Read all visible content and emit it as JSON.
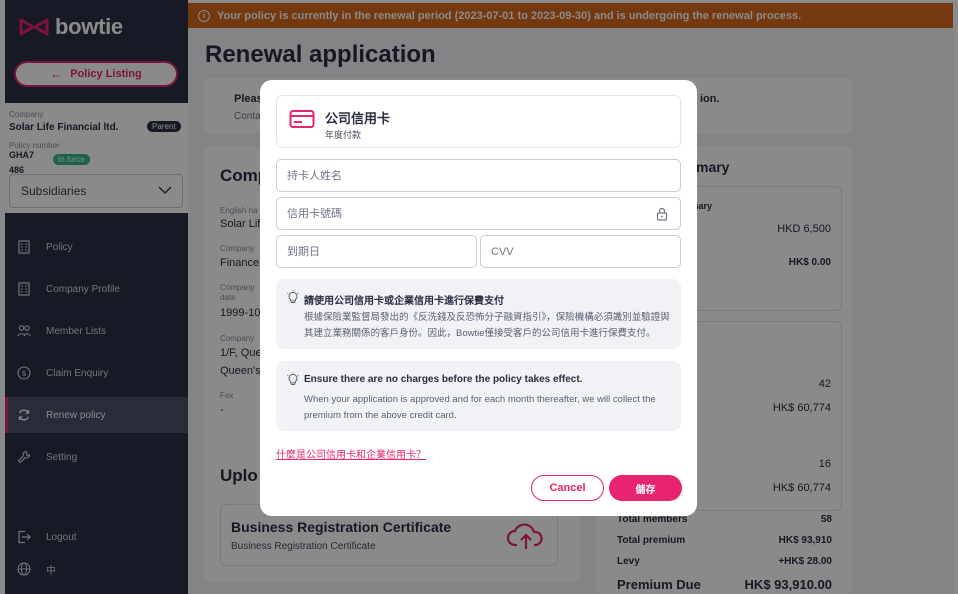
{
  "colors": {
    "brand_pink": "#e8236f",
    "sidebar_bg": "#2c3145",
    "banner_orange": "#d9691c",
    "status_green": "#35b889"
  },
  "app": {
    "logo_text": "bowtie"
  },
  "banner": {
    "text": "Your policy is currently in the renewal period (2023-07-01 to 2023-09-30) and is undergoing the renewal process."
  },
  "sidebar": {
    "policy_listing_label": "Policy Listing",
    "company_label": "Company",
    "company_name": "Solar Life Financial ltd.",
    "parent_badge": "Parent",
    "policy_number_label": "Policy number",
    "policy_number": "GHA7 486",
    "status_badge": "In force",
    "subsidiaries_label": "Subsidiaries",
    "nav": [
      {
        "label": "Policy",
        "icon": "building-icon"
      },
      {
        "label": "Company Profile",
        "icon": "building-icon"
      },
      {
        "label": "Member Lists",
        "icon": "members-icon"
      },
      {
        "label": "Claim Enquiry",
        "icon": "dollar-icon"
      },
      {
        "label": "Renew policy",
        "icon": "renew-icon"
      },
      {
        "label": "Setting",
        "icon": "wrench-icon"
      }
    ],
    "logout_label": "Logout",
    "language_label": "中"
  },
  "main": {
    "page_title": "Renewal application",
    "tip_partial": "Please",
    "tip_partial_2": "Conta",
    "tip_end": "ion.",
    "company_section_partial": "Comp",
    "summary_partial": "mary",
    "english_name_label": "English na",
    "english_name_value": "Solar Lif",
    "company_label_2": "Company",
    "company_value_2": "Finance",
    "company_date_label": "Company date",
    "company_date_value": "1999-10",
    "company_address_label": "Company",
    "address_line1": "1/F, Que",
    "address_line2": "Queen's",
    "fax_label": "Fax",
    "fax_value": "-",
    "upload_partial": "Uplo",
    "brc_title": "Business Registration Certificate",
    "brc_sub": "Business Registration Certificate",
    "summary_sub_partial": "nary",
    "amount_1": "HKD 6,500",
    "amount_2": "HK$ 0.00",
    "count_1": "42",
    "amount_3": "HK$ 60,774",
    "count_2": "16",
    "amount_4": "HK$ 60,774",
    "total_members_label": "Total members",
    "total_members_value": "58",
    "total_premium_label": "Total premium",
    "total_premium_value": "HK$ 93,910",
    "levy_label": "Levy",
    "levy_value": "+HK$ 28.00",
    "premium_due_label": "Premium Due",
    "premium_due_value": "HK$ 93,910.00"
  },
  "modal": {
    "title": "公司信用卡",
    "subtitle": "年度付款",
    "cardholder_placeholder": "持卡人姓名",
    "card_number_placeholder": "信用卡號碼",
    "expiry_placeholder": "到期日",
    "cvv_placeholder": "CVV",
    "notice1_title": "請使用公司信用卡或企業信用卡進行保費支付",
    "notice1_body": "根據保險業監督局發出的《反洗錢及反恐怖分子融資指引》，保險機構必須識別並驗證與其建立業務關係的客戶身份。因此，Bowtie僅接受客戶的公司信用卡進行保費支付。",
    "notice2_title": "Ensure there are no charges before the policy takes effect.",
    "notice2_body": "When your application is approved and for each month thereafter, we will collect the premium from the above credit card.",
    "help_link": "什麼是公司信用卡和企業信用卡？",
    "cancel_label": "Cancel",
    "save_label": "儲存"
  }
}
